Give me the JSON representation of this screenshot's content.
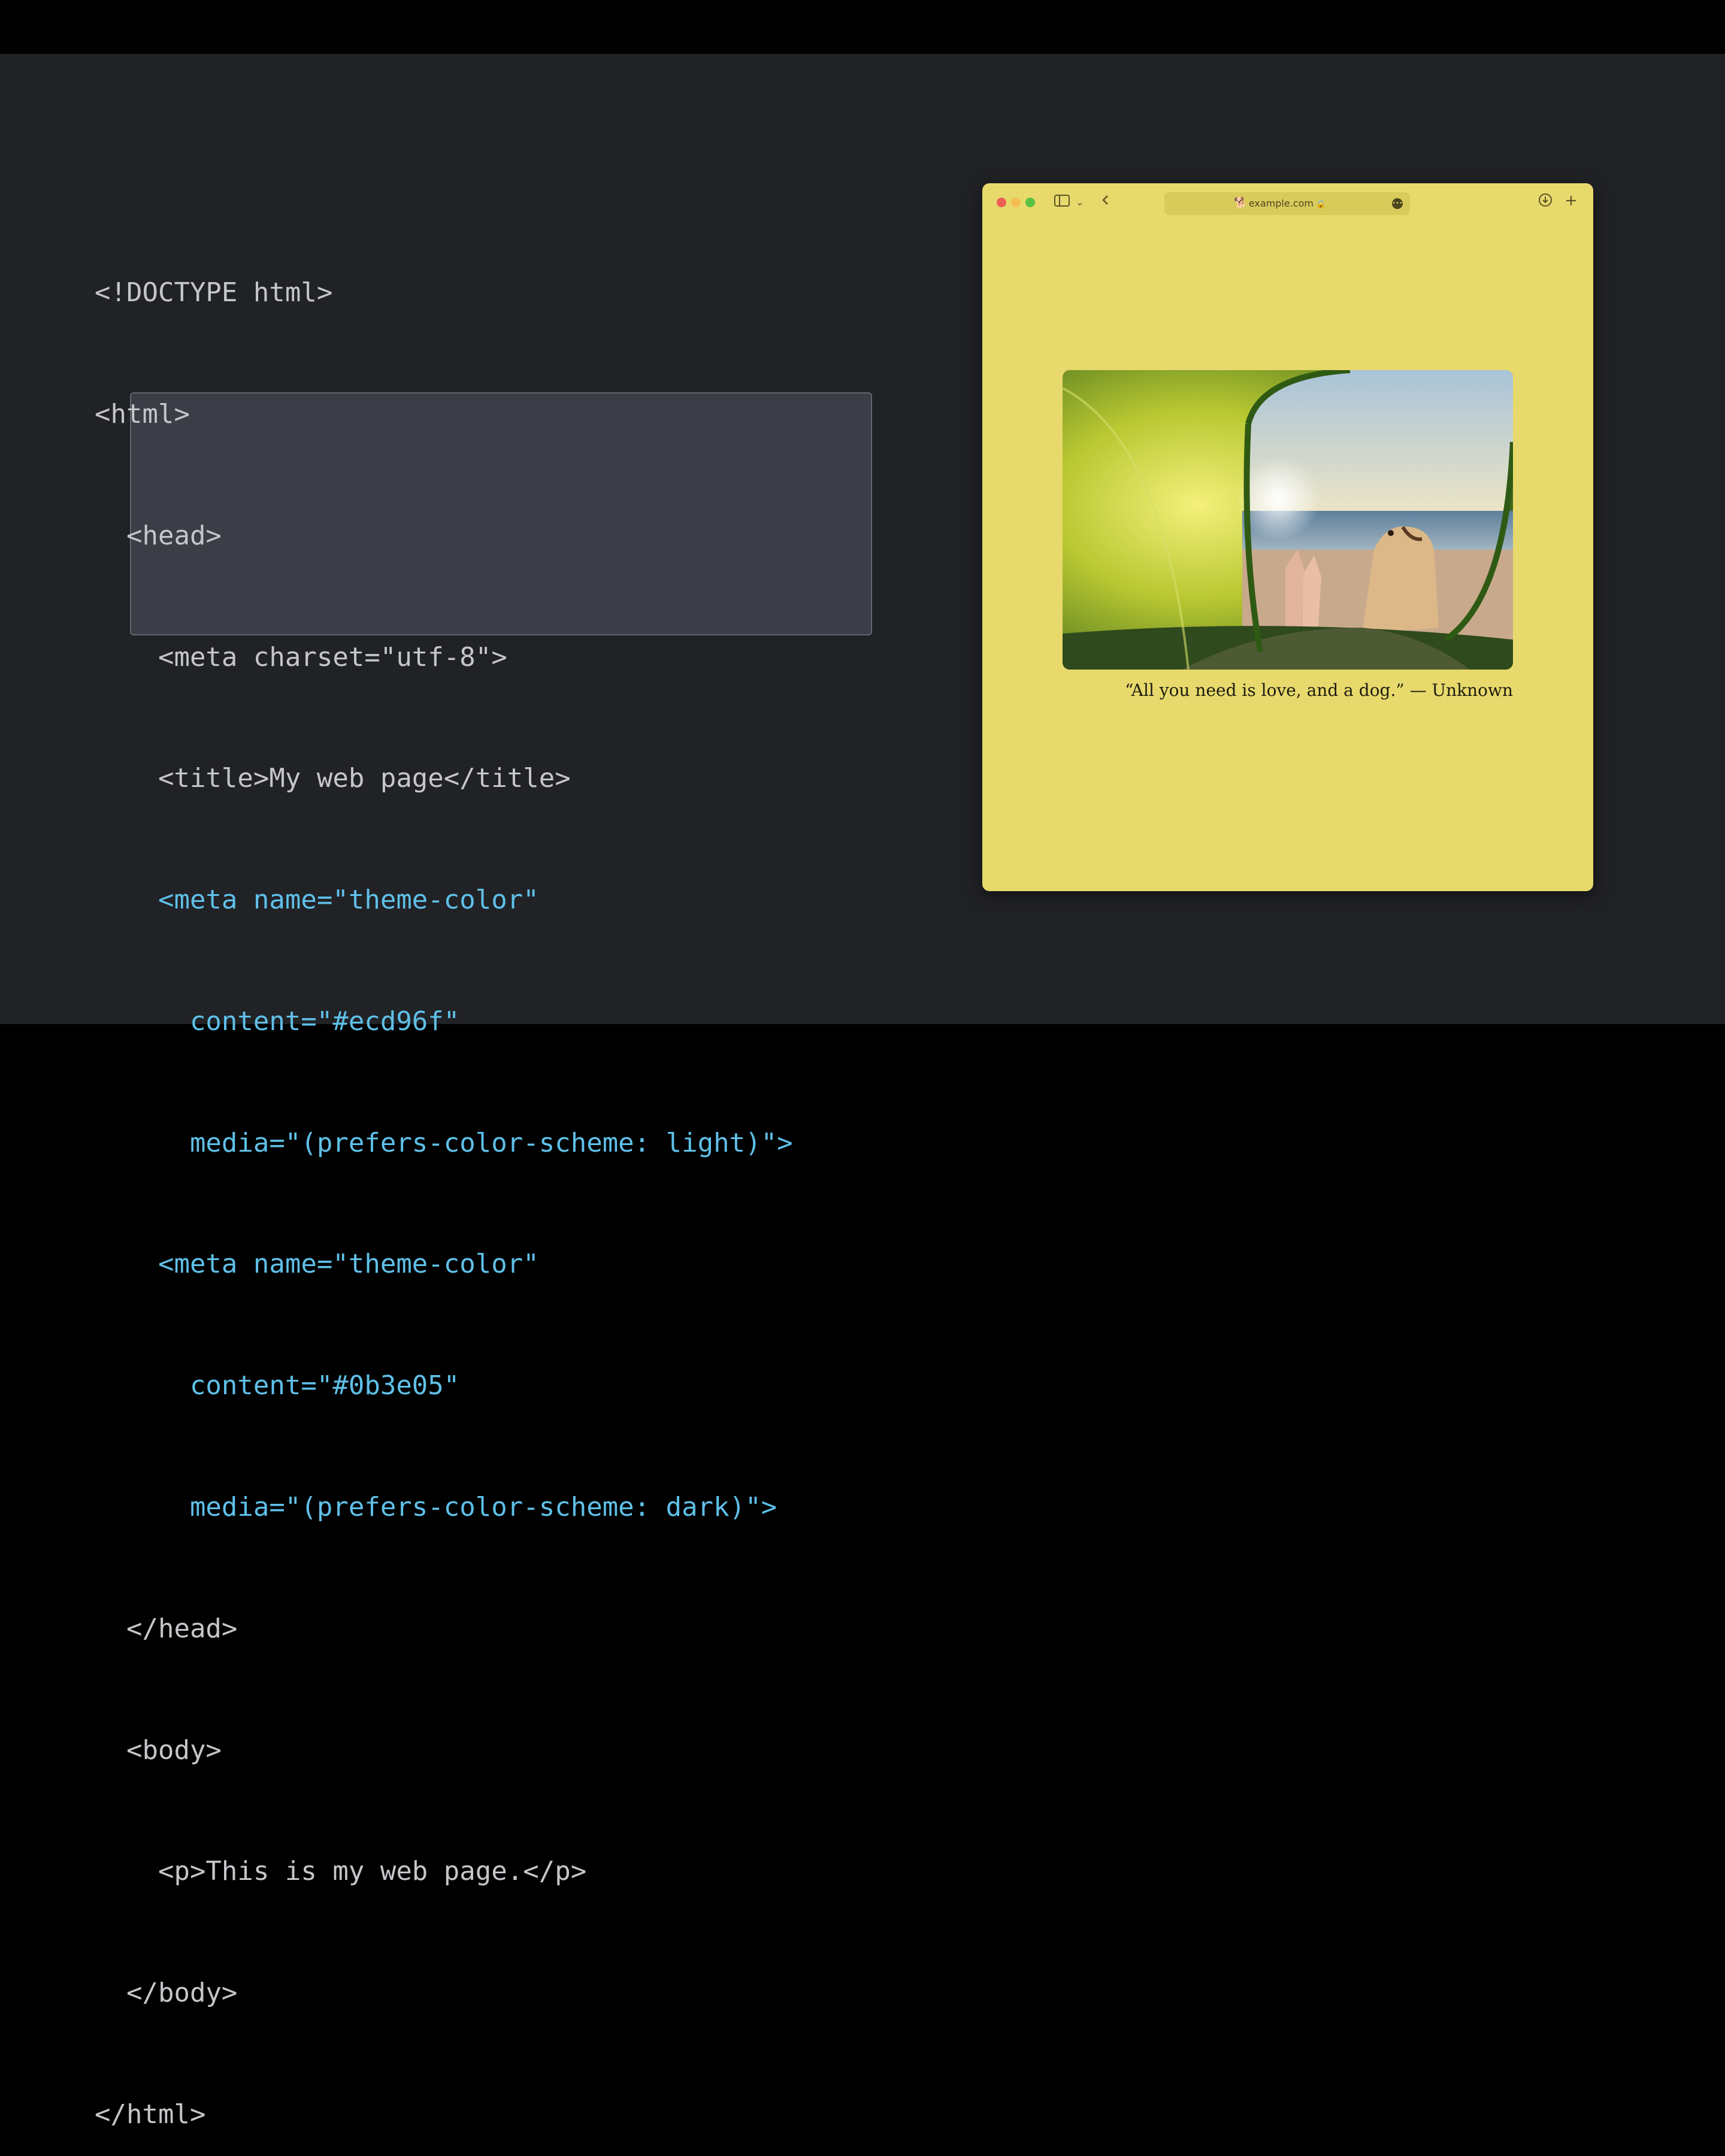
{
  "code": {
    "lines": [
      "<!DOCTYPE html>",
      "<html>",
      "  <head>",
      "    <meta charset=\"utf-8\">",
      "    <title>My web page</title>",
      "    <meta name=\"theme-color\"",
      "      content=\"#ecd96f\"",
      "      media=\"(prefers-color-scheme: light)\">",
      "    <meta name=\"theme-color\"",
      "      content=\"#0b3e05\"",
      "      media=\"(prefers-color-scheme: dark)\">",
      "  </head>",
      "  <body>",
      "    <p>This is my web page.</p>",
      "  </body>",
      "</html>"
    ],
    "highlight_color": "#5fc0e8"
  },
  "browser": {
    "url": "example.com",
    "favicon": "dog-icon",
    "theme_color": "#e7d96c",
    "caption": "“All you need is love, and a dog.” — Unknown",
    "photo_description_icon": "tent-beach-dog-photo"
  },
  "colors": {
    "slide_bg": "#212226",
    "highlight_bg": "#3b3e46",
    "traffic_close": "#ee5f55",
    "traffic_minimize": "#f5bf4f",
    "traffic_zoom": "#58c141"
  }
}
